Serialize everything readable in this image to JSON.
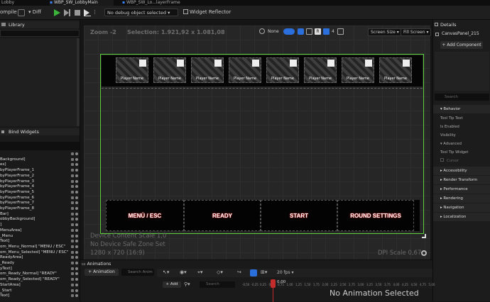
{
  "tabs": [
    {
      "label": "Lobby"
    },
    {
      "label": "WBP_SW_LobbyMain"
    },
    {
      "label": "WBP_SW_Lo...layerFrame"
    }
  ],
  "toolbar": {
    "compile_label": "ompile",
    "diff_label": "Diff",
    "debug_select": "No debug object selected",
    "reflector_label": "Widget Reflector"
  },
  "library": {
    "label": "Library"
  },
  "hierarchy": {
    "header": "Bind Widgets",
    "rows": [
      "",
      "Background]",
      "es]",
      "byPlayerFrame_1",
      "byPlayerFrame_2",
      "byPlayerFrame_3",
      "byPlayerFrame_4",
      "byPlayerFrame_5",
      "byPlayerFrame_6",
      "byPlayerFrame_7",
      "byPlayerFrame_8",
      "Bar]",
      "obbyBackground]",
      "]",
      "MenuArea]",
      "_Menu",
      "Text]",
      "om_Menu_Normal] \"MENÜ / ESC\"",
      "om_Menu_Selected] \"MENÜ / ESC\"",
      "ReadyArea]",
      "_Ready",
      "yText]",
      "om_Ready_Normal] \"READY\"",
      "om_Ready_Selected] \"READY\"",
      "StartArea]",
      "_Start",
      "Text]"
    ]
  },
  "viewport": {
    "zoom": "Zoom -2",
    "selection": "Selection: 1.921,92 x 1.081,08",
    "none_label": "None",
    "r_label": "R",
    "count": "4",
    "screen_size": "Screen Size",
    "fill_screen": "Fill Screen",
    "device_scale": "Device Content Scale 1,0",
    "safe_zone": "No Device Safe Zone Set",
    "resolution": "1280 x 720 (16:9)",
    "dpi": "DPI Scale 0,67"
  },
  "player_frames": [
    {
      "label": "Player Name"
    },
    {
      "label": "Player Name"
    },
    {
      "label": "Player Name"
    },
    {
      "label": "Player Name"
    },
    {
      "label": "Player Name"
    },
    {
      "label": "Player Name"
    },
    {
      "label": "Player Name"
    },
    {
      "label": "Player Name"
    }
  ],
  "buttons": [
    {
      "label": "MENÜ / ESC"
    },
    {
      "label": "READY"
    },
    {
      "label": "START"
    },
    {
      "label": "ROUND SETTINGS"
    }
  ],
  "details": {
    "title": "Details",
    "panel_name": "CanvasPanel_215",
    "add_component": "+ Add Component",
    "search_placeholder": "Search",
    "sections": {
      "behavior": "Behavior",
      "tooltip": "Tool Tip Text",
      "enabled": "Is Enabled",
      "visibility": "Visibility",
      "advanced": "Advanced",
      "tooltip_widget": "Tool Tip Widget",
      "cursor": "Cursor",
      "accessibility": "Accessibility",
      "render": "Render Transform",
      "performance": "Performance",
      "rendering": "Rendering",
      "navigation": "Navigation",
      "localization": "Localization"
    }
  },
  "animations": {
    "tab": "Animations",
    "add_button": "+ Animation",
    "search_placeholder": "Search Anim",
    "fps": "20 fps",
    "add_track": "+ Add",
    "track_search": "Search",
    "time": "0,00",
    "empty": "No Animation Selected",
    "ticks": [
      "-0,50",
      "-0,25",
      "0,25",
      "0,50",
      "0,75",
      "1,00",
      "1,25",
      "1,50",
      "1,75",
      "2,00",
      "2,25",
      "2,50",
      "2,75",
      "3,00",
      "3,25",
      "3,50",
      "3,75",
      "4,00",
      "4,25",
      "4,50",
      "4,75",
      "5,00"
    ]
  },
  "colors": {
    "canvas_outline": "#5ad03a",
    "button_glow": "#d02020",
    "accent": "#2a6fdb"
  }
}
